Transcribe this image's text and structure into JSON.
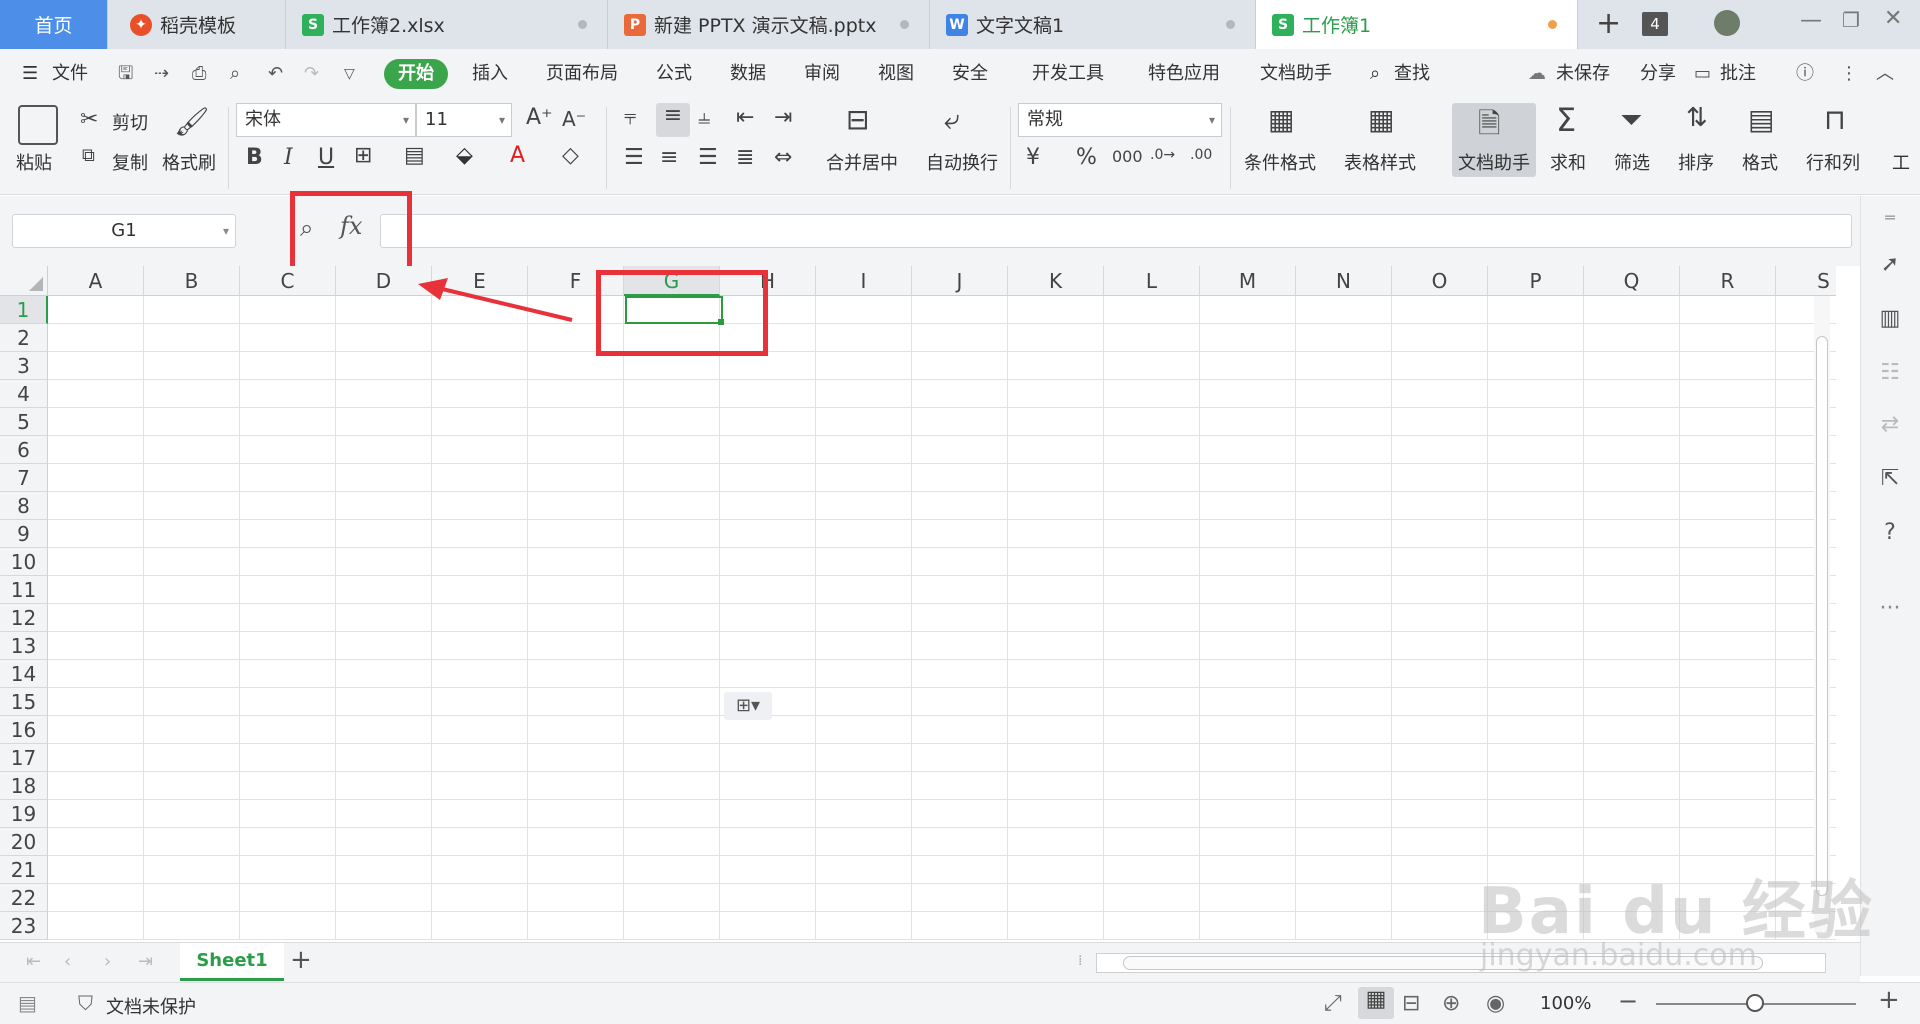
{
  "tabs": {
    "home": "首页",
    "templates": "稻壳模板",
    "workbook2": "工作簿2.xlsx",
    "pptx": "新建 PPTX 演示文稿.pptx",
    "doc": "文字文稿1",
    "active": "工作簿1",
    "window_count": "4"
  },
  "menu": {
    "file": "文件",
    "start": "开始",
    "insert": "插入",
    "layout": "页面布局",
    "formula": "公式",
    "data": "数据",
    "review": "审阅",
    "view": "视图",
    "security": "安全",
    "dev": "开发工具",
    "special": "特色应用",
    "assistant": "文档助手",
    "search": "查找",
    "unsaved": "未保存",
    "share": "分享",
    "comment": "批注"
  },
  "ribbon": {
    "paste": "粘贴",
    "cut": "剪切",
    "copy": "复制",
    "format_painter": "格式刷",
    "font": "宋体",
    "font_size": "11",
    "merge_center": "合并居中",
    "wrap": "自动换行",
    "number_format": "常规",
    "conditional": "条件格式",
    "table_style": "表格样式",
    "doc_assistant": "文档助手",
    "sum": "求和",
    "filter": "筛选",
    "sort": "排序",
    "format": "格式",
    "rows_cols": "行和列",
    "more": "工"
  },
  "formula_bar": {
    "cell_ref": "G1",
    "fx": "fx",
    "value": ""
  },
  "columns": [
    "A",
    "B",
    "C",
    "D",
    "E",
    "F",
    "G",
    "H",
    "I",
    "J",
    "K",
    "L",
    "M",
    "N",
    "O",
    "P",
    "Q",
    "R",
    "S"
  ],
  "rows": [
    "1",
    "2",
    "3",
    "4",
    "5",
    "6",
    "7",
    "8",
    "9",
    "10",
    "11",
    "12",
    "13",
    "14",
    "15",
    "16",
    "17",
    "18",
    "19",
    "20",
    "21",
    "22",
    "23"
  ],
  "selected_cell": "G1",
  "sheets": {
    "active": "Sheet1"
  },
  "status": {
    "protect": "文档未保护",
    "zoom": "100%"
  },
  "watermark": {
    "brand": "Bai du 经验",
    "url": "jingyan.baidu.com"
  },
  "colors": {
    "accent_green": "#3aa54a",
    "home_blue": "#4d8fe8",
    "annotation_red": "#e8323a"
  }
}
